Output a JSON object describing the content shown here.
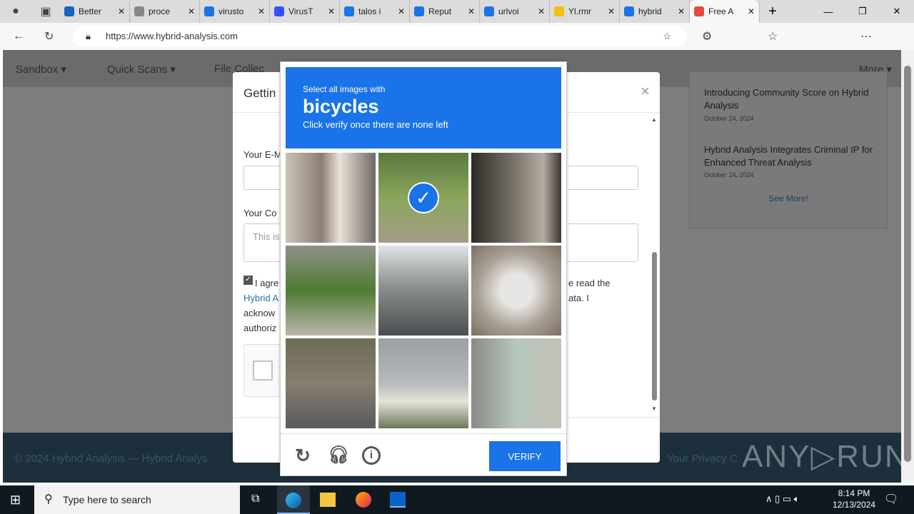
{
  "browser": {
    "tabs": [
      {
        "label": "Better",
        "color": "#1565c0"
      },
      {
        "label": "proce",
        "color": "#888"
      },
      {
        "label": "virusto",
        "color": "#1a73e8"
      },
      {
        "label": "VirusT",
        "color": "#394eff"
      },
      {
        "label": "talos i",
        "color": "#1a73e8"
      },
      {
        "label": "Reput",
        "color": "#1a73e8"
      },
      {
        "label": "urlvoi",
        "color": "#1a73e8"
      },
      {
        "label": "Yl.rmr",
        "color": "#f2c200"
      },
      {
        "label": "hybrid",
        "color": "#1a73e8"
      },
      {
        "label": "Free A",
        "color": "#e04b3c",
        "active": true
      }
    ],
    "url": "https://www.hybrid-analysis.com"
  },
  "nav": {
    "items": [
      "Sandbox ▾",
      "Quick Scans ▾",
      "File Collec"
    ],
    "more": "More ▾"
  },
  "news": {
    "items": [
      {
        "title": "Introducing Community Score on Hybrid Analysis",
        "date": "October 24, 2024"
      },
      {
        "title": "Hybrid Analysis Integrates Criminal IP for Enhanced Threat Analysis",
        "date": "October 24, 2024"
      }
    ],
    "see_more": "See More!"
  },
  "modal": {
    "title": "Gettin",
    "email_label": "Your E-M",
    "comment_label": "Your Co",
    "comment_placeholder": "This is",
    "agree_lines": [
      "I agre",
      "Hybrid A",
      "acknow",
      "authoriz"
    ],
    "agree_right": [
      "e read the",
      "ata. I"
    ],
    "close": "×"
  },
  "captcha": {
    "prompt": "Select all images with",
    "target": "bicycles",
    "instruction": "Click verify once there are none left",
    "verify_label": "VERIFY",
    "tiles": [
      {
        "subject": "storefront",
        "selected": false
      },
      {
        "subject": "cyclist",
        "selected": true
      },
      {
        "subject": "old bicycle",
        "selected": false
      },
      {
        "subject": "garden",
        "selected": false
      },
      {
        "subject": "highway bus",
        "selected": false
      },
      {
        "subject": "fire hydrant",
        "selected": false
      },
      {
        "subject": "street car",
        "selected": false
      },
      {
        "subject": "building",
        "selected": false
      },
      {
        "subject": "teal bicycle",
        "selected": false
      }
    ]
  },
  "footer": {
    "left": "© 2024 Hybrid Analysis — Hybrid Analys",
    "right": "Your Privacy C",
    "watermark": "ANY RUN"
  },
  "taskbar": {
    "search_placeholder": "Type here to search",
    "time": "8:14 PM",
    "date": "12/13/2024"
  }
}
